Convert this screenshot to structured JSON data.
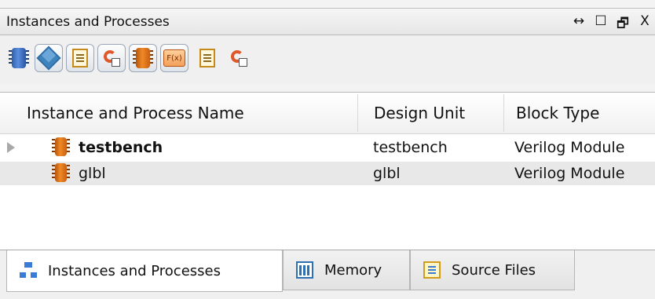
{
  "panel": {
    "title": "Instances and Processes",
    "controls": {
      "move": "↔",
      "maximize": "☐",
      "restore": "🗗",
      "close": "X"
    }
  },
  "toolbar": {
    "buttons": [
      {
        "icon": "module-chip-blue-icon",
        "toggled": false
      },
      {
        "icon": "cube-icon",
        "toggled": true
      },
      {
        "icon": "document-icon",
        "toggled": true
      },
      {
        "icon": "refresh-icon",
        "toggled": true
      },
      {
        "icon": "chip-orange-icon",
        "toggled": true
      },
      {
        "icon": "function-icon",
        "label": "F(x)",
        "toggled": true
      },
      {
        "icon": "document-icon",
        "toggled": false
      },
      {
        "icon": "refresh-icon",
        "toggled": false
      }
    ]
  },
  "table": {
    "columns": [
      "Instance and Process Name",
      "Design Unit",
      "Block Type"
    ],
    "rows": [
      {
        "name": "testbench",
        "design_unit": "testbench",
        "block_type": "Verilog Module",
        "expandable": true,
        "bold": true
      },
      {
        "name": "glbl",
        "design_unit": "glbl",
        "block_type": "Verilog Module",
        "expandable": false,
        "bold": false
      }
    ]
  },
  "tabs": [
    {
      "label": "Instances and Processes",
      "icon": "hierarchy-icon",
      "active": true
    },
    {
      "label": "Memory",
      "icon": "memory-icon",
      "active": false
    },
    {
      "label": "Source Files",
      "icon": "source-files-icon",
      "active": false
    }
  ]
}
